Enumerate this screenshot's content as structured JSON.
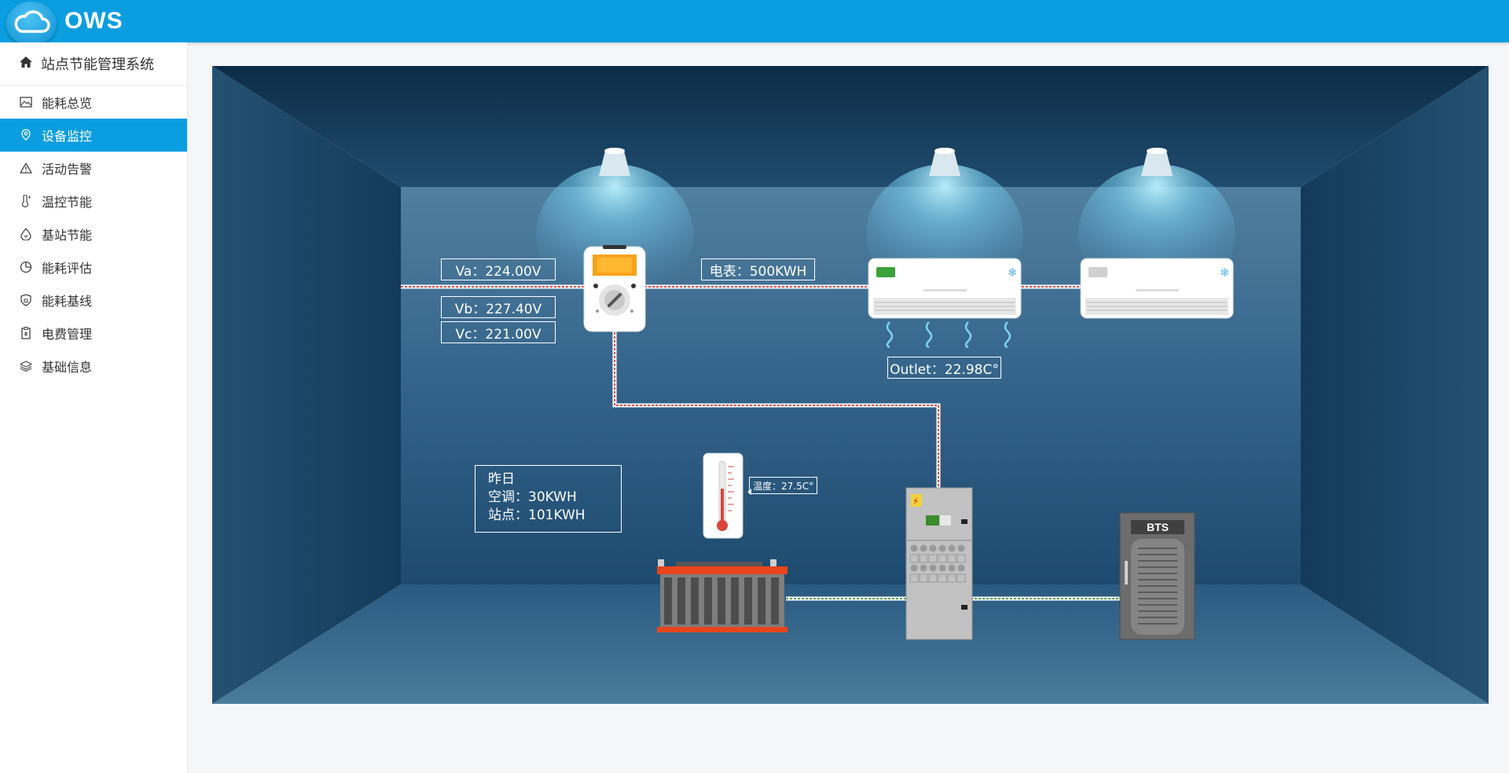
{
  "app": {
    "logo_text": "OWS"
  },
  "sidebar": {
    "title": "站点节能管理系统",
    "items": [
      {
        "label": "能耗总览",
        "icon": "image-icon",
        "active": false
      },
      {
        "label": "设备监控",
        "icon": "location-icon",
        "active": true
      },
      {
        "label": "活动告警",
        "icon": "warning-icon",
        "active": false
      },
      {
        "label": "温控节能",
        "icon": "thermometer-icon",
        "active": false
      },
      {
        "label": "基站节能",
        "icon": "drop-icon",
        "active": false
      },
      {
        "label": "能耗评估",
        "icon": "pie-chart-icon",
        "active": false
      },
      {
        "label": "能耗基线",
        "icon": "shield-icon",
        "active": false
      },
      {
        "label": "电费管理",
        "icon": "bill-icon",
        "active": false
      },
      {
        "label": "基础信息",
        "icon": "layers-icon",
        "active": false
      }
    ]
  },
  "monitor": {
    "va": "Va：224.00V",
    "vb": "Vb：227.40V",
    "vc": "Vc：221.00V",
    "meter": "电表：500KWH",
    "outlet": "Outlet：22.98C°",
    "temperature": "温度：27.5C°",
    "yesterday": {
      "title": "昨日",
      "ac": "空调：30KWH",
      "site": "站点：101KWH"
    },
    "bts_label": "BTS"
  },
  "colors": {
    "header": "#0a9ee0",
    "active_nav": "#0a9ee0",
    "room_back": "#3b6a8c",
    "battery_accent": "#e8451c"
  }
}
